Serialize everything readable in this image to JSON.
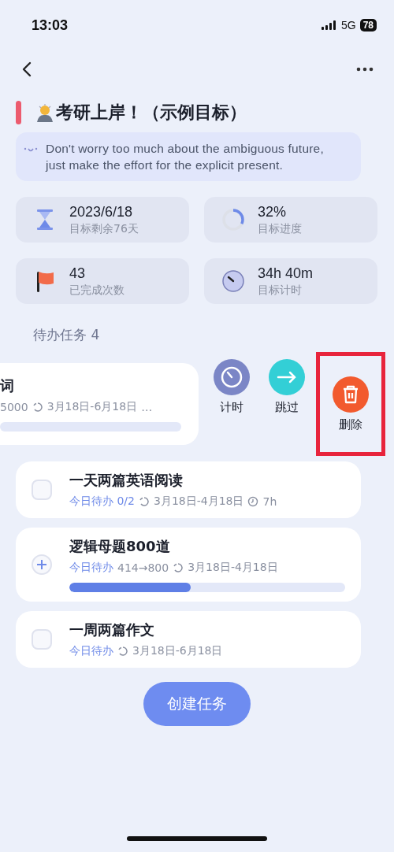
{
  "status_bar": {
    "time": "13:03",
    "network": "5G",
    "battery": "78"
  },
  "goal": {
    "title": "考研上岸！（示例目标）",
    "quote": "Don't worry too much about the ambiguous future, just make the effort for the explicit present."
  },
  "stats": [
    {
      "kind": "deadline",
      "value": "2023/6/18",
      "label": "目标剩余76天"
    },
    {
      "kind": "progress",
      "value": "32%",
      "label": "目标进度",
      "level": 0.32
    },
    {
      "kind": "count",
      "value": "43",
      "label": "已完成次数"
    },
    {
      "kind": "timer",
      "value": "34h 40m",
      "label": "目标计时"
    }
  ],
  "section": {
    "title": "待办任务 4"
  },
  "tasks": [
    {
      "kind": "swiped",
      "title": "词",
      "meta": [
        {
          "kind": "count",
          "text": "5000"
        },
        {
          "kind": "range",
          "text": "3月18日-6月18日"
        },
        {
          "kind": "more",
          "text": "…"
        }
      ],
      "level": 0
    },
    {
      "kind": "checkbox",
      "checked": false,
      "title": "一天两篇英语阅读",
      "meta": [
        {
          "kind": "today",
          "text": "今日待办 0/2"
        },
        {
          "kind": "range",
          "text": "3月18日-4月18日"
        },
        {
          "kind": "duration",
          "text": "7h"
        }
      ]
    },
    {
      "kind": "counter",
      "title": "逻辑母题800道",
      "meta": [
        {
          "kind": "today",
          "text": "今日待办"
        },
        {
          "kind": "count",
          "text": "414→800"
        },
        {
          "kind": "range",
          "text": "3月18日-4月18日"
        }
      ],
      "level": 0.44
    },
    {
      "kind": "checkbox",
      "checked": false,
      "title": "一周两篇作文",
      "meta": [
        {
          "kind": "today",
          "text": "今日待办"
        },
        {
          "kind": "range",
          "text": "3月18日-6月18日"
        }
      ]
    }
  ],
  "swipe_actions": [
    {
      "kind": "timer",
      "label": "计时",
      "color": "#7b86c6"
    },
    {
      "kind": "skip",
      "label": "跳过",
      "color": "#33cfd6"
    },
    {
      "kind": "delete",
      "label": "删除",
      "color": "#f25a2e",
      "highlighted": true
    }
  ],
  "create_button": {
    "label": "创建任务"
  }
}
